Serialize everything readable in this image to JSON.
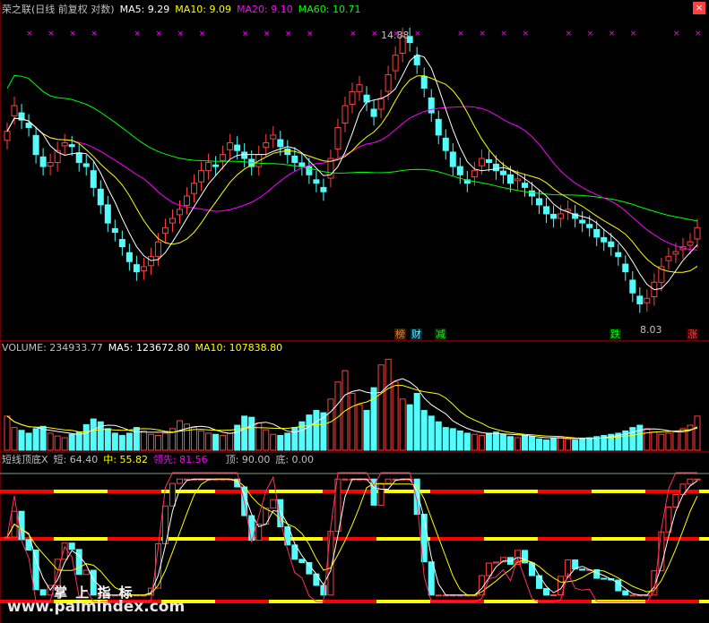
{
  "colors": {
    "up": "#ff4040",
    "down": "#54fcfc",
    "ma5": "#ffffff",
    "ma10": "#ffff00",
    "ma20": "#ff00ff",
    "ma60": "#00ff00",
    "neutral": "#c0c0c0",
    "band_red": "#ff0000",
    "band_yellow": "#ffff00",
    "guide": "#ffffff",
    "bgAxis": "#c00000"
  },
  "icons": {
    "marker": "purple-x-marker-icon",
    "close": "close-icon"
  },
  "main_panel": {
    "title": "荣之联(日线 前复权 对数)",
    "ma5": "MA5: 9.29",
    "ma10": "MA10: 9.09",
    "ma20": "MA20: 9.10",
    "ma60": "MA60: 10.71",
    "high_label": "14.88",
    "low_label": "8.03",
    "tags": [
      {
        "text": "榜",
        "color": "#ff8000"
      },
      {
        "text": "财",
        "color": "#54fcfc"
      },
      {
        "text": "减",
        "color": "#00ff00"
      },
      {
        "text": "跌",
        "color": "#00ff00"
      },
      {
        "text": "涨",
        "color": "#ff4040"
      }
    ]
  },
  "volume_panel": {
    "vol": "VOLUME: 234933.77",
    "ma5": "MA5: 123672.80",
    "ma10": "MA10: 107838.80"
  },
  "indicator_panel": {
    "name": "短线顶底X",
    "short": "短: 64.40",
    "mid": "中: 55.82",
    "lead": "领先: 81.56",
    "top": "顶: 90.00",
    "bottom": "底: 0.00"
  },
  "watermark": {
    "brand": "掌 上 指 标",
    "url": "www.palmindex.com"
  },
  "chart_data": {
    "type": "candlestick",
    "series": "荣之联 daily K-line (log scale, forward-adjusted)",
    "y_min_visible": 8.03,
    "y_max_visible": 14.88,
    "closes": [
      11.9,
      12.6,
      12.2,
      12.0,
      11.3,
      11.0,
      11.1,
      11.4,
      11.6,
      11.5,
      11.1,
      11.0,
      10.5,
      10.1,
      9.7,
      9.5,
      9.2,
      8.9,
      8.7,
      8.8,
      9.0,
      9.3,
      9.6,
      9.8,
      10.0,
      10.3,
      10.6,
      10.9,
      11.1,
      11.0,
      11.3,
      11.6,
      11.4,
      11.2,
      11.0,
      11.3,
      11.6,
      11.8,
      11.5,
      11.3,
      11.1,
      11.0,
      10.8,
      10.6,
      10.4,
      11.2,
      12.0,
      12.6,
      13.0,
      13.2,
      12.7,
      12.3,
      12.8,
      13.5,
      14.1,
      14.7,
      14.5,
      13.8,
      13.1,
      12.4,
      11.8,
      11.4,
      11.0,
      10.8,
      10.6,
      10.9,
      11.2,
      11.1,
      10.9,
      10.8,
      10.6,
      10.7,
      10.5,
      10.3,
      10.1,
      9.9,
      9.8,
      9.9,
      10.0,
      9.8,
      9.7,
      9.6,
      9.4,
      9.3,
      9.2,
      9.0,
      8.7,
      8.3,
      8.1,
      8.2,
      8.5,
      8.8,
      9.0,
      9.1,
      9.2,
      9.3,
      9.6
    ],
    "volumes": [
      60,
      40,
      35,
      30,
      38,
      42,
      30,
      25,
      22,
      28,
      32,
      45,
      55,
      50,
      38,
      30,
      26,
      30,
      40,
      34,
      28,
      26,
      30,
      38,
      52,
      46,
      40,
      34,
      30,
      28,
      26,
      30,
      44,
      60,
      58,
      48,
      36,
      28,
      26,
      30,
      40,
      50,
      62,
      70,
      66,
      90,
      120,
      140,
      100,
      80,
      70,
      110,
      150,
      160,
      120,
      90,
      80,
      100,
      70,
      60,
      50,
      40,
      38,
      34,
      30,
      28,
      26,
      30,
      32,
      28,
      24,
      22,
      26,
      24,
      20,
      18,
      22,
      24,
      20,
      18,
      20,
      22,
      24,
      26,
      28,
      30,
      34,
      40,
      44,
      38,
      32,
      28,
      30,
      34,
      38,
      44,
      60
    ],
    "indicator": {
      "short": 64.4,
      "mid": 55.82,
      "lead": 81.56,
      "top": 90.0,
      "bottom": 0.0
    }
  }
}
